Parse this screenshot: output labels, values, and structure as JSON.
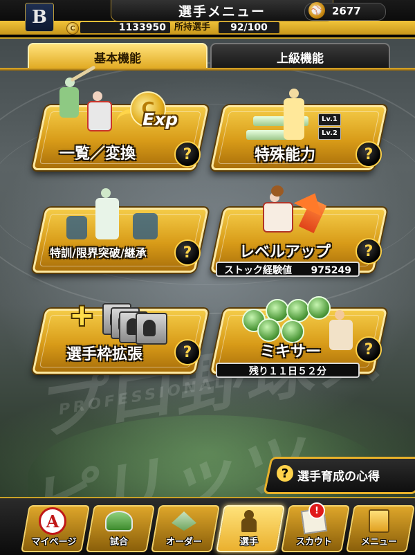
{
  "header": {
    "team_logo": "B",
    "title": "選手メニュー",
    "gold_value": "2677",
    "money_value": "1133950",
    "players_label": "所持選手",
    "players_value": "92/100"
  },
  "tabs": [
    {
      "label": "基本機能",
      "active": true
    },
    {
      "label": "上級機能",
      "active": false
    }
  ],
  "menu": {
    "list_exchange": {
      "label": "一覧／変換",
      "icon": "exp-icon",
      "exp_text": "Exp"
    },
    "special_ability": {
      "label": "特殊能力",
      "lv1": "Lv.1",
      "lv2": "Lv.2"
    },
    "training": {
      "label": "特訓/限界突破/継承"
    },
    "level_up": {
      "label": "レベルアップ",
      "stock_label": "ストック経験値",
      "stock_value": "975249"
    },
    "slot_expand": {
      "label": "選手枠拡張",
      "plus": "+"
    },
    "mixer": {
      "label": "ミキサー",
      "remaining": "残り１１日５２分"
    }
  },
  "help_glyph": "?",
  "tips_button": {
    "label": "選手育成の心得",
    "glyph": "?"
  },
  "nav": [
    {
      "label": "マイページ",
      "icon": "mypage-icon",
      "glyph": "A"
    },
    {
      "label": "試合",
      "icon": "stadium-icon"
    },
    {
      "label": "オーダー",
      "icon": "order-icon"
    },
    {
      "label": "選手",
      "icon": "player-icon",
      "active": true
    },
    {
      "label": "スカウト",
      "icon": "scout-icon",
      "badge": "!"
    },
    {
      "label": "メニュー",
      "icon": "menu-icon"
    }
  ],
  "watermark": {
    "big": "プロ野球スピリッツ",
    "small": "PROFESSIONAL"
  }
}
